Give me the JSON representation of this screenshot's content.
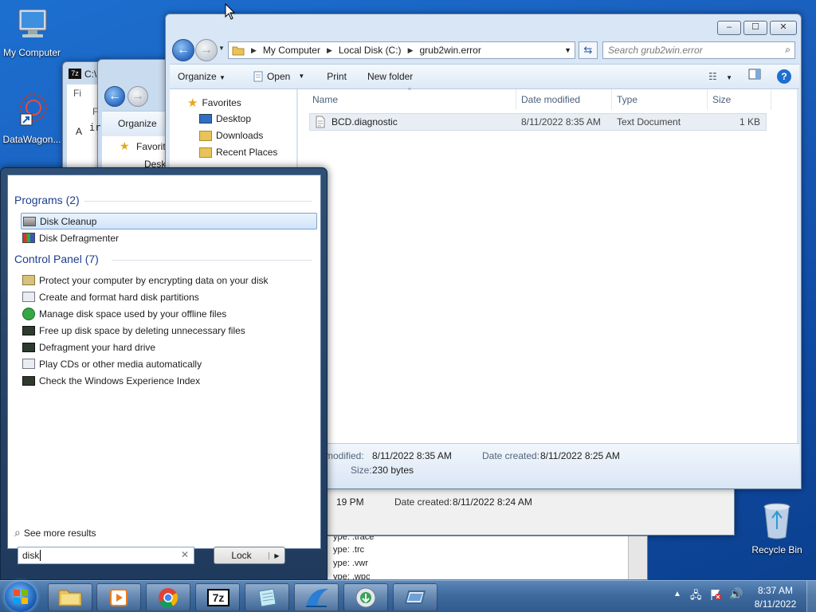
{
  "desktop": {
    "icons": [
      {
        "label": "My Computer",
        "icon": "computer-icon"
      },
      {
        "label": "DataWagon...",
        "icon": "shortcut-icon"
      },
      {
        "label": "Recycle Bin",
        "icon": "recycle-bin-icon"
      }
    ]
  },
  "bg_windows": {
    "w1_title": "C:\\",
    "w1_menu_partial": "Fi",
    "w1_side_a": "A",
    "w2_organize": "Organize",
    "w2_favorites": "Favorit",
    "w2_desk": "Desk",
    "w2_file_partial": "F",
    "w2_text_partial": "ir",
    "w3_time": "19 PM",
    "w3_created_label": "Date created:",
    "w3_created_value": "8/11/2022 8:24 AM",
    "console_lines": [
      "ype: .trace",
      "ype: .trc",
      "ype: .vwr",
      "ype: .wpc"
    ]
  },
  "explorer": {
    "breadcrumbs": [
      "My Computer",
      "Local Disk (C:)",
      "grub2win.error"
    ],
    "search_placeholder": "Search grub2win.error",
    "toolbar": {
      "organize": "Organize",
      "open": "Open",
      "print": "Print",
      "new_folder": "New folder"
    },
    "nav": {
      "favorites": "Favorites",
      "items": [
        "Desktop",
        "Downloads",
        "Recent Places"
      ]
    },
    "columns": [
      "Name",
      "Date modified",
      "Type",
      "Size"
    ],
    "files": [
      {
        "name": "BCD.diagnostic",
        "modified": "8/11/2022 8:35 AM",
        "type": "Text Document",
        "size": "1 KB"
      }
    ],
    "details": {
      "modified_label": "modified:",
      "modified_value": "8/11/2022 8:35 AM",
      "created_label": "Date created:",
      "created_value": "8/11/2022 8:25 AM",
      "size_label": "Size:",
      "size_value": "230 bytes"
    },
    "caption": {
      "minimize": "–",
      "maximize": "☐",
      "close": "✕"
    }
  },
  "start_menu": {
    "programs_header": "Programs (2)",
    "programs": [
      "Disk Cleanup",
      "Disk Defragmenter"
    ],
    "control_panel_header": "Control Panel (7)",
    "control_panel": [
      "Protect your computer by encrypting data on your disk",
      "Create and format hard disk partitions",
      "Manage disk space used by your offline files",
      "Free up disk space by deleting unnecessary files",
      "Defragment your hard drive",
      "Play CDs or other media automatically",
      "Check the Windows Experience Index"
    ],
    "see_more": "See more results",
    "search_value": "disk",
    "lock_label": "Lock"
  },
  "taskbar": {
    "apps": [
      "explorer-icon",
      "media-player-icon",
      "chrome-icon",
      "7zip-icon",
      "notepad-icon",
      "app-icon",
      "network-icon",
      "display-icon"
    ],
    "clock_time": "8:37 AM",
    "clock_date": "8/11/2022"
  }
}
